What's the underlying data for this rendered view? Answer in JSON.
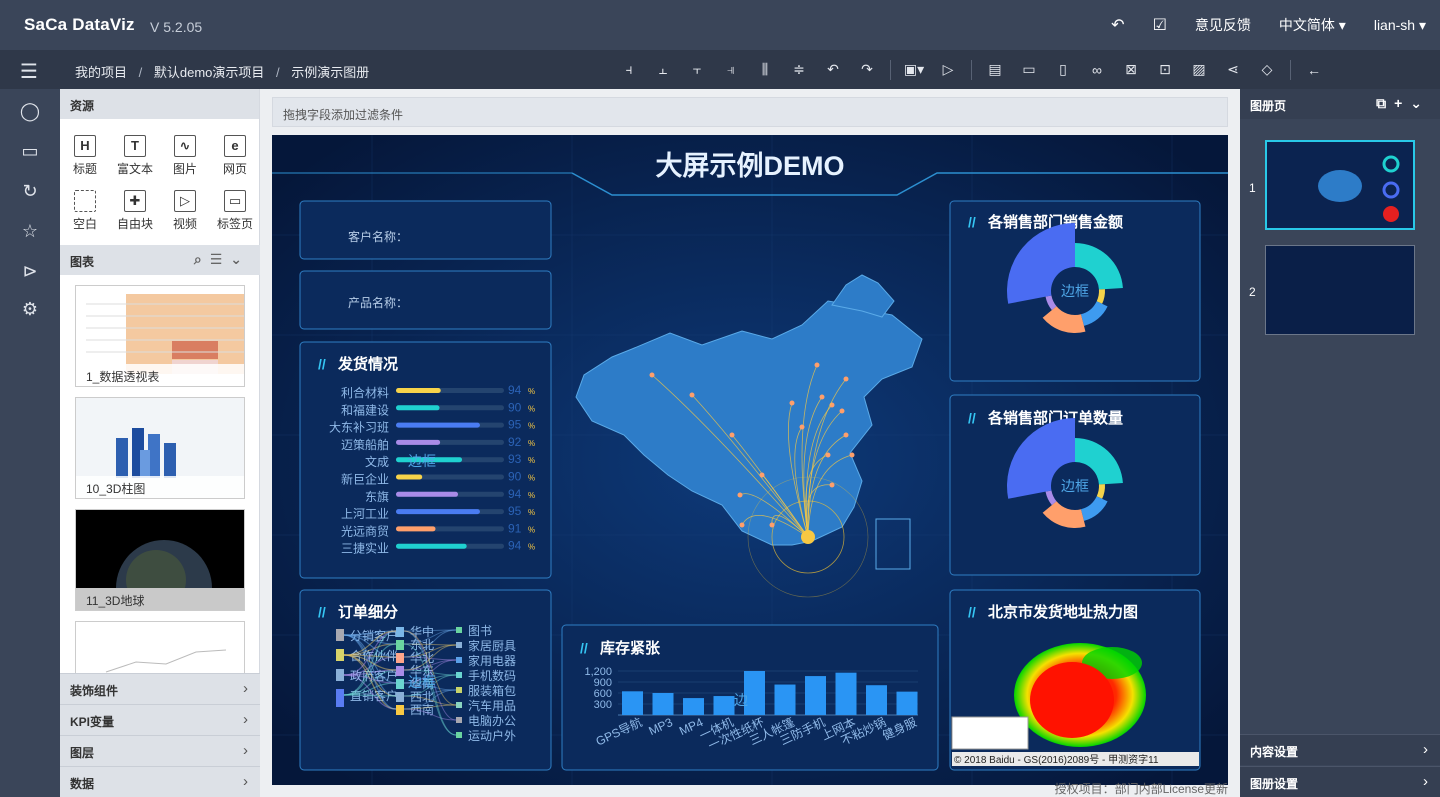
{
  "app": {
    "brand": "SaCa DataViz",
    "version": "V 5.2.05"
  },
  "topbar": {
    "feedback": "意见反馈",
    "language": "中文简体 ▾",
    "user": "lian-sh ▾"
  },
  "breadcrumb": {
    "items": [
      "我的项目",
      "默认demo演示项目",
      "示例演示图册"
    ],
    "sep": "/"
  },
  "left_panel": {
    "resources_title": "资源",
    "resources": [
      {
        "icon": "H",
        "label": "标题"
      },
      {
        "icon": "T",
        "label": "富文本"
      },
      {
        "icon": "∿",
        "label": "图片"
      },
      {
        "icon": "e",
        "label": "网页"
      },
      {
        "icon": "",
        "label": "空白"
      },
      {
        "icon": "✚",
        "label": "自由块"
      },
      {
        "icon": "▷",
        "label": "视频"
      },
      {
        "icon": "▭",
        "label": "标签页"
      }
    ],
    "charts_title": "图表",
    "chart_thumbs": [
      "1_数据透视表",
      "10_3D柱图",
      "11_3D地球",
      ""
    ],
    "accordions": [
      "装饰组件",
      "KPI变量",
      "图层",
      "数据"
    ]
  },
  "canvas": {
    "filter_placeholder": "拖拽字段添加过滤条件",
    "license": "授权项目：部门内部License更新"
  },
  "dashboard": {
    "title": "大屏示例DEMO",
    "customer_label": "客户名称：",
    "product_label": "产品名称：",
    "ship_title": "发货情况",
    "ship_border_label": "边框",
    "order_title": "订单细分",
    "order_border_label": "边框",
    "stock_title": "库存紧张",
    "stock_border_label": "边",
    "sales_title": "各销售部门销售金额",
    "sales_border_label": "边框",
    "orders_title": "各销售部门订单数量",
    "orders_border_label": "边框",
    "beijing_title": "北京市发货地址热力图",
    "map_copyright": "© 2018 Baidu - GS(2016)2089号 - 甲测资字11",
    "order_left": [
      "分销客户",
      "合作伙伴",
      "政府客户",
      "直销客户"
    ],
    "order_mid": [
      "华中",
      "东北",
      "华北",
      "华东",
      "华南",
      "西北",
      "西南"
    ],
    "order_right": [
      "图书",
      "家居厨具",
      "家用电器",
      "手机数码",
      "服装箱包",
      "汽车用品",
      "电脑办公",
      "运动户外"
    ]
  },
  "chart_data": [
    {
      "type": "bar",
      "title": "发货情况",
      "categories": [
        "利合材料",
        "和福建设",
        "大东补习班",
        "迈策船舶",
        "文成",
        "新巨企业",
        "东旗",
        "上河工业",
        "光远商贸",
        "三捷实业"
      ],
      "values": [
        94,
        90,
        95,
        92,
        93,
        90,
        94,
        95,
        91,
        94
      ],
      "unit": "%"
    },
    {
      "type": "bar",
      "title": "库存紧张",
      "categories": [
        "GPS导航",
        "MP3",
        "MP4",
        "一体机",
        "一次性纸杯",
        "三人帐篷",
        "三防手机",
        "上网本",
        "不粘炒锅",
        "健身服"
      ],
      "values": [
        700,
        650,
        500,
        560,
        1300,
        900,
        1150,
        1250,
        880,
        690
      ],
      "yticks": [
        "1,200",
        "900",
        "600",
        "300"
      ],
      "ylim": [
        0,
        1300
      ]
    },
    {
      "type": "pie",
      "title": "各销售部门销售金额",
      "values": [
        24,
        8,
        14,
        18,
        8,
        28
      ],
      "colors": [
        "#1fd1d0",
        "#f5d34a",
        "#3e9bf0",
        "#ff9f6b",
        "#a98be8",
        "#4a6cf2"
      ]
    },
    {
      "type": "pie",
      "title": "各销售部门订单数量",
      "values": [
        24,
        8,
        14,
        18,
        8,
        28
      ],
      "colors": [
        "#1fd1d0",
        "#f5d34a",
        "#3e9bf0",
        "#ff9f6b",
        "#a98be8",
        "#4a6cf2"
      ]
    }
  ],
  "right_panel": {
    "title": "图册页",
    "pages": [
      "1",
      "2"
    ],
    "accordions": [
      "内容设置",
      "图册设置"
    ]
  }
}
